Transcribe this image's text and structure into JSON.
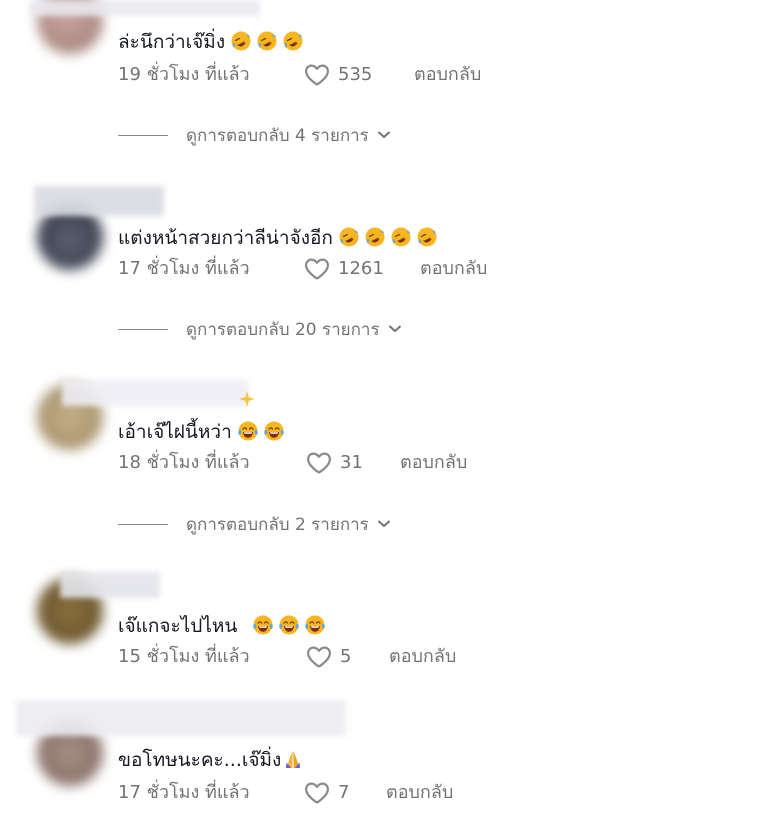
{
  "comments": [
    {
      "text": "ล่ะนึกว่าเจ๊มิ่ง",
      "time": "19 ชั่วโมง ที่แล้ว",
      "likes": "535",
      "reply": "ตอบกลับ",
      "view_replies": "ดูการตอบกลับ 4 รายการ",
      "emojis": [
        "rofl-emoji",
        "rofl-emoji",
        "rofl-emoji"
      ]
    },
    {
      "text": "แต่งหน้าสวยกว่าลีน่าจังอีก",
      "time": "17 ชั่วโมง ที่แล้ว",
      "likes": "1261",
      "reply": "ตอบกลับ",
      "view_replies": "ดูการตอบกลับ 20 รายการ",
      "emojis": [
        "rofl-emoji",
        "rofl-emoji",
        "rofl-emoji",
        "rofl-emoji"
      ]
    },
    {
      "text": "เอ้าเจ๊ไฝนี้หว่า",
      "time": "18 ชั่วโมง ที่แล้ว",
      "likes": "31",
      "reply": "ตอบกลับ",
      "view_replies": "ดูการตอบกลับ 2 รายการ",
      "emojis": [
        "tears-of-joy-emoji",
        "tears-of-joy-emoji"
      ]
    },
    {
      "text": "เจ๊แกจะไปไหน",
      "time": "15 ชั่วโมง ที่แล้ว",
      "likes": "5",
      "reply": "ตอบกลับ",
      "emojis": [
        "tears-of-joy-emoji",
        "tears-of-joy-emoji",
        "tears-of-joy-emoji"
      ]
    },
    {
      "text": "ขอโทษนะคะ...เจ๊มิ่ง",
      "time": "17 ชั่วโมง ที่แล้ว",
      "likes": "7",
      "reply": "ตอบกลับ",
      "emojis": [
        "pray-emoji"
      ]
    }
  ],
  "colors": {
    "text": "#161823",
    "muted": "#737373",
    "background": "#ffffff"
  }
}
